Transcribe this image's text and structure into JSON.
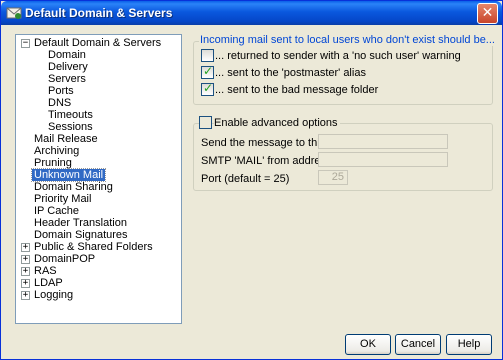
{
  "window": {
    "title": "Default Domain & Servers",
    "close_label": "✕"
  },
  "tree": {
    "items": [
      {
        "label": "Default Domain & Servers",
        "expander": "−"
      },
      {
        "label": "Domain"
      },
      {
        "label": "Delivery"
      },
      {
        "label": "Servers"
      },
      {
        "label": "Ports"
      },
      {
        "label": "DNS"
      },
      {
        "label": "Timeouts"
      },
      {
        "label": "Sessions"
      },
      {
        "label": "Mail Release"
      },
      {
        "label": "Archiving"
      },
      {
        "label": "Pruning"
      },
      {
        "label": "Unknown Mail",
        "selected": true
      },
      {
        "label": "Domain Sharing"
      },
      {
        "label": "Priority Mail"
      },
      {
        "label": "IP Cache"
      },
      {
        "label": "Header Translation"
      },
      {
        "label": "Domain Signatures"
      },
      {
        "label": "Public & Shared Folders",
        "expander": "+"
      },
      {
        "label": "DomainPOP",
        "expander": "+"
      },
      {
        "label": "RAS",
        "expander": "+"
      },
      {
        "label": "LDAP",
        "expander": "+"
      },
      {
        "label": "Logging",
        "expander": "+"
      }
    ]
  },
  "incoming": {
    "heading": "Incoming mail sent to local users who don't exist should be...",
    "options": [
      {
        "label": "... returned to sender with a 'no such user' warning",
        "checked": false
      },
      {
        "label": "... sent to the 'postmaster' alias",
        "checked": true
      },
      {
        "label": "... sent to the bad message folder",
        "checked": true
      }
    ]
  },
  "advanced": {
    "heading": "Enable advanced options",
    "checked": false,
    "host_label": "Send the message to this host",
    "host_value": "",
    "smtp_label": "SMTP 'MAIL' from address",
    "smtp_value": "",
    "port_label": "Port (default = 25)",
    "port_value": "25"
  },
  "buttons": {
    "ok": "OK",
    "cancel": "Cancel",
    "help": "Help"
  }
}
